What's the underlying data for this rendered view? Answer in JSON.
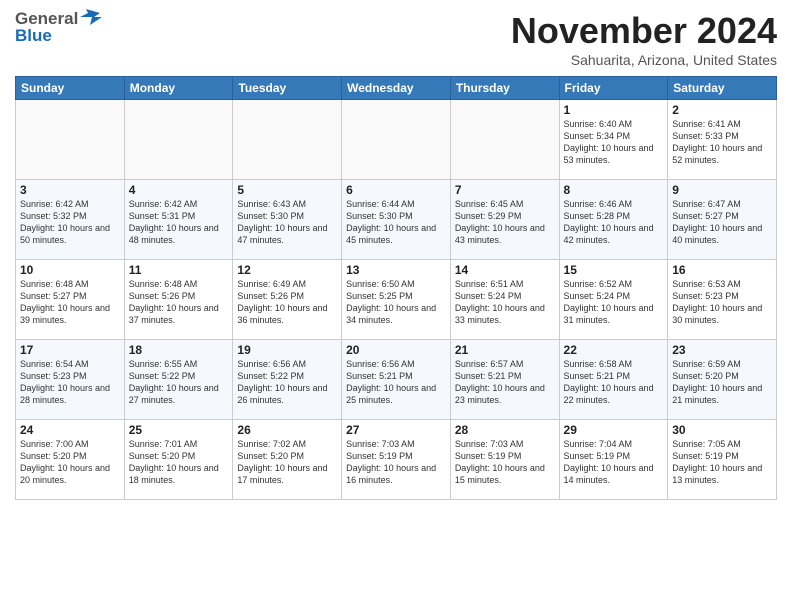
{
  "header": {
    "logo_general": "General",
    "logo_blue": "Blue",
    "month": "November 2024",
    "location": "Sahuarita, Arizona, United States"
  },
  "weekdays": [
    "Sunday",
    "Monday",
    "Tuesday",
    "Wednesday",
    "Thursday",
    "Friday",
    "Saturday"
  ],
  "weeks": [
    [
      {
        "day": "",
        "info": ""
      },
      {
        "day": "",
        "info": ""
      },
      {
        "day": "",
        "info": ""
      },
      {
        "day": "",
        "info": ""
      },
      {
        "day": "",
        "info": ""
      },
      {
        "day": "1",
        "info": "Sunrise: 6:40 AM\nSunset: 5:34 PM\nDaylight: 10 hours and 53 minutes."
      },
      {
        "day": "2",
        "info": "Sunrise: 6:41 AM\nSunset: 5:33 PM\nDaylight: 10 hours and 52 minutes."
      }
    ],
    [
      {
        "day": "3",
        "info": "Sunrise: 6:42 AM\nSunset: 5:32 PM\nDaylight: 10 hours and 50 minutes."
      },
      {
        "day": "4",
        "info": "Sunrise: 6:42 AM\nSunset: 5:31 PM\nDaylight: 10 hours and 48 minutes."
      },
      {
        "day": "5",
        "info": "Sunrise: 6:43 AM\nSunset: 5:30 PM\nDaylight: 10 hours and 47 minutes."
      },
      {
        "day": "6",
        "info": "Sunrise: 6:44 AM\nSunset: 5:30 PM\nDaylight: 10 hours and 45 minutes."
      },
      {
        "day": "7",
        "info": "Sunrise: 6:45 AM\nSunset: 5:29 PM\nDaylight: 10 hours and 43 minutes."
      },
      {
        "day": "8",
        "info": "Sunrise: 6:46 AM\nSunset: 5:28 PM\nDaylight: 10 hours and 42 minutes."
      },
      {
        "day": "9",
        "info": "Sunrise: 6:47 AM\nSunset: 5:27 PM\nDaylight: 10 hours and 40 minutes."
      }
    ],
    [
      {
        "day": "10",
        "info": "Sunrise: 6:48 AM\nSunset: 5:27 PM\nDaylight: 10 hours and 39 minutes."
      },
      {
        "day": "11",
        "info": "Sunrise: 6:48 AM\nSunset: 5:26 PM\nDaylight: 10 hours and 37 minutes."
      },
      {
        "day": "12",
        "info": "Sunrise: 6:49 AM\nSunset: 5:26 PM\nDaylight: 10 hours and 36 minutes."
      },
      {
        "day": "13",
        "info": "Sunrise: 6:50 AM\nSunset: 5:25 PM\nDaylight: 10 hours and 34 minutes."
      },
      {
        "day": "14",
        "info": "Sunrise: 6:51 AM\nSunset: 5:24 PM\nDaylight: 10 hours and 33 minutes."
      },
      {
        "day": "15",
        "info": "Sunrise: 6:52 AM\nSunset: 5:24 PM\nDaylight: 10 hours and 31 minutes."
      },
      {
        "day": "16",
        "info": "Sunrise: 6:53 AM\nSunset: 5:23 PM\nDaylight: 10 hours and 30 minutes."
      }
    ],
    [
      {
        "day": "17",
        "info": "Sunrise: 6:54 AM\nSunset: 5:23 PM\nDaylight: 10 hours and 28 minutes."
      },
      {
        "day": "18",
        "info": "Sunrise: 6:55 AM\nSunset: 5:22 PM\nDaylight: 10 hours and 27 minutes."
      },
      {
        "day": "19",
        "info": "Sunrise: 6:56 AM\nSunset: 5:22 PM\nDaylight: 10 hours and 26 minutes."
      },
      {
        "day": "20",
        "info": "Sunrise: 6:56 AM\nSunset: 5:21 PM\nDaylight: 10 hours and 25 minutes."
      },
      {
        "day": "21",
        "info": "Sunrise: 6:57 AM\nSunset: 5:21 PM\nDaylight: 10 hours and 23 minutes."
      },
      {
        "day": "22",
        "info": "Sunrise: 6:58 AM\nSunset: 5:21 PM\nDaylight: 10 hours and 22 minutes."
      },
      {
        "day": "23",
        "info": "Sunrise: 6:59 AM\nSunset: 5:20 PM\nDaylight: 10 hours and 21 minutes."
      }
    ],
    [
      {
        "day": "24",
        "info": "Sunrise: 7:00 AM\nSunset: 5:20 PM\nDaylight: 10 hours and 20 minutes."
      },
      {
        "day": "25",
        "info": "Sunrise: 7:01 AM\nSunset: 5:20 PM\nDaylight: 10 hours and 18 minutes."
      },
      {
        "day": "26",
        "info": "Sunrise: 7:02 AM\nSunset: 5:20 PM\nDaylight: 10 hours and 17 minutes."
      },
      {
        "day": "27",
        "info": "Sunrise: 7:03 AM\nSunset: 5:19 PM\nDaylight: 10 hours and 16 minutes."
      },
      {
        "day": "28",
        "info": "Sunrise: 7:03 AM\nSunset: 5:19 PM\nDaylight: 10 hours and 15 minutes."
      },
      {
        "day": "29",
        "info": "Sunrise: 7:04 AM\nSunset: 5:19 PM\nDaylight: 10 hours and 14 minutes."
      },
      {
        "day": "30",
        "info": "Sunrise: 7:05 AM\nSunset: 5:19 PM\nDaylight: 10 hours and 13 minutes."
      }
    ]
  ]
}
